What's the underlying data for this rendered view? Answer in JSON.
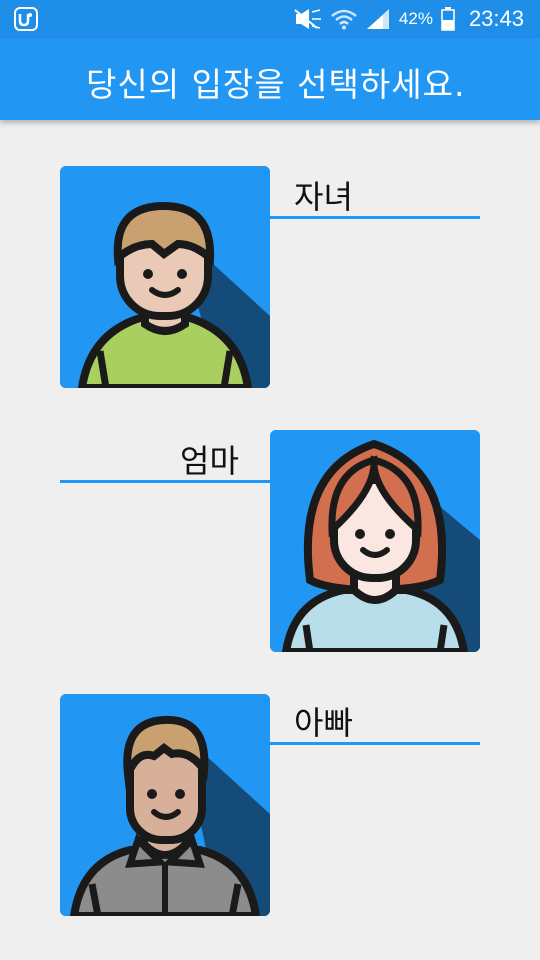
{
  "status": {
    "battery_percent": "42%",
    "time": "23:43"
  },
  "header": {
    "title": "당신의 입장을 선택하세요."
  },
  "roles": [
    {
      "label": "자녀",
      "avatar": "child-avatar-icon"
    },
    {
      "label": "엄마",
      "avatar": "mom-avatar-icon"
    },
    {
      "label": "아빠",
      "avatar": "dad-avatar-icon"
    }
  ],
  "colors": {
    "primary": "#2196f3",
    "status_bar": "#1e8ee8",
    "background": "#efefef"
  }
}
